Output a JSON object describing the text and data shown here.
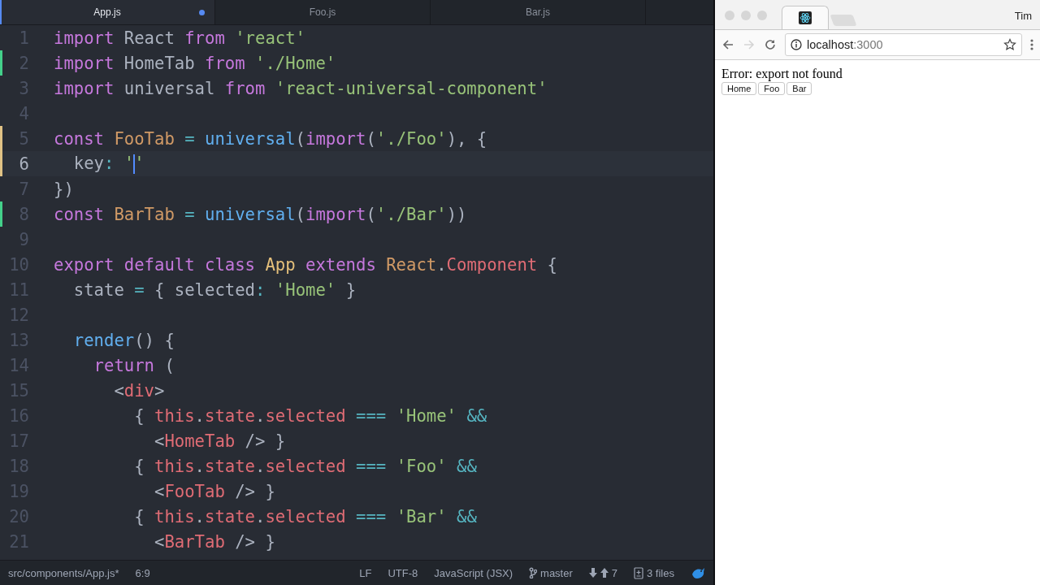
{
  "editor": {
    "tabs": [
      {
        "label": "App.js",
        "selected": true,
        "modified": true
      },
      {
        "label": "Foo.js",
        "selected": false,
        "modified": false
      },
      {
        "label": "Bar.js",
        "selected": false,
        "modified": false
      }
    ],
    "lines": [
      {
        "number": "1",
        "added": false,
        "modified": false,
        "current": false,
        "tokens": [
          {
            "kind": "keyword",
            "s": "import "
          },
          {
            "kind": "plain",
            "s": "React "
          },
          {
            "kind": "keyword",
            "s": "from "
          },
          {
            "kind": "string",
            "s": "'react'"
          }
        ]
      },
      {
        "number": "2",
        "added": true,
        "modified": false,
        "current": false,
        "tokens": [
          {
            "kind": "keyword",
            "s": "import "
          },
          {
            "kind": "plain",
            "s": "HomeTab "
          },
          {
            "kind": "keyword",
            "s": "from "
          },
          {
            "kind": "string",
            "s": "'./Home'"
          }
        ]
      },
      {
        "number": "3",
        "added": false,
        "modified": false,
        "current": false,
        "tokens": [
          {
            "kind": "keyword",
            "s": "import "
          },
          {
            "kind": "plain",
            "s": "universal "
          },
          {
            "kind": "keyword",
            "s": "from "
          },
          {
            "kind": "string",
            "s": "'react-universal-component'"
          }
        ]
      },
      {
        "number": "4",
        "added": false,
        "modified": false,
        "current": false
      },
      {
        "number": "5",
        "added": false,
        "modified": true,
        "current": false,
        "tokens": [
          {
            "kind": "keyword",
            "s": "const "
          },
          {
            "kind": "type",
            "s": "FooTab "
          },
          {
            "kind": "operator",
            "s": "= "
          },
          {
            "kind": "function",
            "s": "universal"
          },
          {
            "kind": "plain",
            "s": "("
          },
          {
            "kind": "keyword",
            "s": "import"
          },
          {
            "kind": "plain",
            "s": "("
          },
          {
            "kind": "string",
            "s": "'./Foo'"
          },
          {
            "kind": "plain",
            "s": "), {"
          }
        ]
      },
      {
        "number": "6",
        "added": false,
        "modified": true,
        "current": true,
        "tokens": [
          {
            "kind": "plain",
            "s": "  key"
          },
          {
            "kind": "operator",
            "s": ": "
          },
          {
            "kind": "string",
            "s": "'"
          },
          {
            "kind": "caret"
          },
          {
            "kind": "string",
            "s": "'"
          }
        ]
      },
      {
        "number": "7",
        "added": false,
        "modified": false,
        "current": false,
        "tokens": [
          {
            "kind": "plain",
            "s": "})"
          }
        ]
      },
      {
        "number": "8",
        "added": true,
        "modified": false,
        "current": false,
        "tokens": [
          {
            "kind": "keyword",
            "s": "const "
          },
          {
            "kind": "type",
            "s": "BarTab "
          },
          {
            "kind": "operator",
            "s": "= "
          },
          {
            "kind": "function",
            "s": "universal"
          },
          {
            "kind": "plain",
            "s": "("
          },
          {
            "kind": "keyword",
            "s": "import"
          },
          {
            "kind": "plain",
            "s": "("
          },
          {
            "kind": "string",
            "s": "'./Bar'"
          },
          {
            "kind": "plain",
            "s": "))"
          }
        ]
      },
      {
        "number": "9",
        "added": false,
        "modified": false,
        "current": false
      },
      {
        "number": "10",
        "added": false,
        "modified": false,
        "current": false,
        "tokens": [
          {
            "kind": "keyword",
            "s": "export default class "
          },
          {
            "kind": "class",
            "s": "App "
          },
          {
            "kind": "keyword",
            "s": "extends "
          },
          {
            "kind": "type",
            "s": "React"
          },
          {
            "kind": "plain",
            "s": "."
          },
          {
            "kind": "tag",
            "s": "Component"
          },
          {
            "kind": "plain",
            "s": " {"
          }
        ]
      },
      {
        "number": "11",
        "added": false,
        "modified": false,
        "current": false,
        "tokens": [
          {
            "kind": "plain",
            "s": "  state "
          },
          {
            "kind": "operator",
            "s": "= "
          },
          {
            "kind": "plain",
            "s": "{ selected"
          },
          {
            "kind": "operator",
            "s": ": "
          },
          {
            "kind": "string",
            "s": "'Home'"
          },
          {
            "kind": "plain",
            "s": " }"
          }
        ]
      },
      {
        "number": "12",
        "added": false,
        "modified": false,
        "current": false
      },
      {
        "number": "13",
        "added": false,
        "modified": false,
        "current": false,
        "tokens": [
          {
            "kind": "function",
            "s": "  render"
          },
          {
            "kind": "plain",
            "s": "() {"
          }
        ]
      },
      {
        "number": "14",
        "added": false,
        "modified": false,
        "current": false,
        "tokens": [
          {
            "kind": "keyword",
            "s": "    return "
          },
          {
            "kind": "plain",
            "s": "("
          }
        ]
      },
      {
        "number": "15",
        "added": false,
        "modified": false,
        "current": false,
        "tokens": [
          {
            "kind": "plain",
            "s": "      <"
          },
          {
            "kind": "tag",
            "s": "div"
          },
          {
            "kind": "plain",
            "s": ">"
          }
        ]
      },
      {
        "number": "16",
        "added": false,
        "modified": false,
        "current": false,
        "tokens": [
          {
            "kind": "plain",
            "s": "        { "
          },
          {
            "kind": "tag",
            "s": "this"
          },
          {
            "kind": "plain",
            "s": "."
          },
          {
            "kind": "tag",
            "s": "state"
          },
          {
            "kind": "plain",
            "s": "."
          },
          {
            "kind": "tag",
            "s": "selected "
          },
          {
            "kind": "operator",
            "s": "=== "
          },
          {
            "kind": "string",
            "s": "'Home' "
          },
          {
            "kind": "operator",
            "s": "&&"
          }
        ]
      },
      {
        "number": "17",
        "added": false,
        "modified": false,
        "current": false,
        "tokens": [
          {
            "kind": "plain",
            "s": "          <"
          },
          {
            "kind": "tag",
            "s": "HomeTab"
          },
          {
            "kind": "plain",
            "s": " /> }"
          }
        ]
      },
      {
        "number": "18",
        "added": false,
        "modified": false,
        "current": false,
        "tokens": [
          {
            "kind": "plain",
            "s": "        { "
          },
          {
            "kind": "tag",
            "s": "this"
          },
          {
            "kind": "plain",
            "s": "."
          },
          {
            "kind": "tag",
            "s": "state"
          },
          {
            "kind": "plain",
            "s": "."
          },
          {
            "kind": "tag",
            "s": "selected "
          },
          {
            "kind": "operator",
            "s": "=== "
          },
          {
            "kind": "string",
            "s": "'Foo' "
          },
          {
            "kind": "operator",
            "s": "&&"
          }
        ]
      },
      {
        "number": "19",
        "added": false,
        "modified": false,
        "current": false,
        "tokens": [
          {
            "kind": "plain",
            "s": "          <"
          },
          {
            "kind": "tag",
            "s": "FooTab"
          },
          {
            "kind": "plain",
            "s": " /> }"
          }
        ]
      },
      {
        "number": "20",
        "added": false,
        "modified": false,
        "current": false,
        "tokens": [
          {
            "kind": "plain",
            "s": "        { "
          },
          {
            "kind": "tag",
            "s": "this"
          },
          {
            "kind": "plain",
            "s": "."
          },
          {
            "kind": "tag",
            "s": "state"
          },
          {
            "kind": "plain",
            "s": "."
          },
          {
            "kind": "tag",
            "s": "selected "
          },
          {
            "kind": "operator",
            "s": "=== "
          },
          {
            "kind": "string",
            "s": "'Bar' "
          },
          {
            "kind": "operator",
            "s": "&&"
          }
        ]
      },
      {
        "number": "21",
        "added": false,
        "modified": false,
        "current": false,
        "tokens": [
          {
            "kind": "plain",
            "s": "          <"
          },
          {
            "kind": "tag",
            "s": "BarTab"
          },
          {
            "kind": "plain",
            "s": " /> }"
          }
        ]
      }
    ],
    "status_bar": {
      "path": "src/components/App.js*",
      "position": "6:9",
      "line_ending": "LF",
      "encoding": "UTF-8",
      "grammar": "JavaScript (JSX)",
      "branch": "master",
      "ahead": "7",
      "changes": "3 files"
    }
  },
  "browser": {
    "profile": "Tim",
    "forward_disabled": true,
    "url_host": "localhost",
    "url_port": ":3000",
    "page": {
      "error": "Error: export not found",
      "buttons": [
        "Home",
        "Foo",
        "Bar"
      ]
    }
  }
}
